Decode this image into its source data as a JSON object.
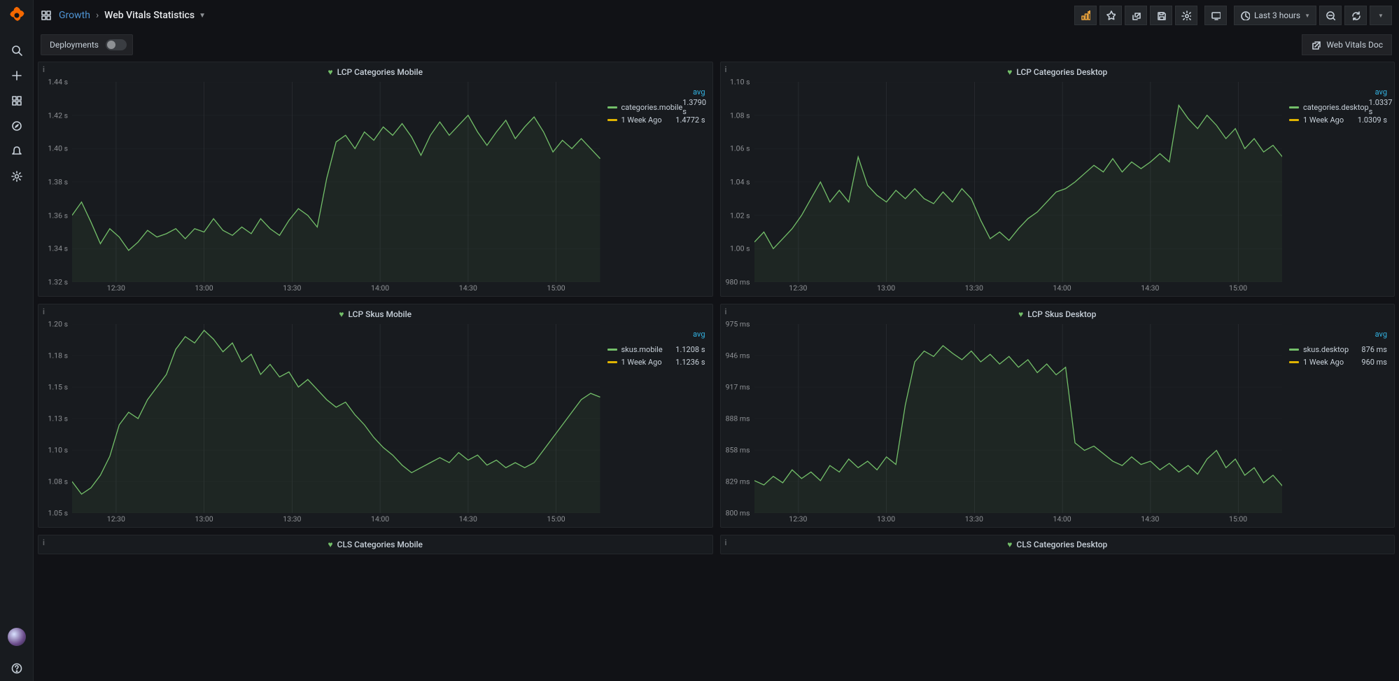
{
  "breadcrumb": {
    "folder": "Growth",
    "title": "Web Vitals Statistics"
  },
  "timepicker": {
    "range_label": "Last 3 hours"
  },
  "submenu": {
    "var_label": "Deployments",
    "doc_link_label": "Web Vitals Doc"
  },
  "legend_header": "avg",
  "panels": [
    {
      "id": "lcp_cat_mobile",
      "title": "LCP Categories Mobile",
      "ylim": [
        1.32,
        1.44
      ],
      "yunit": " s",
      "yfmt": 2,
      "legend": [
        {
          "swatch": "green",
          "label": "categories.mobile",
          "value": "1.3790 s"
        },
        {
          "swatch": "yellow",
          "label": "1 Week Ago",
          "value": "1.4772 s"
        }
      ]
    },
    {
      "id": "lcp_cat_desktop",
      "title": "LCP Categories Desktop",
      "ylim": [
        0.98,
        1.1
      ],
      "yunit": " s",
      "yfmt": 2,
      "ytick_override": [
        "1.10 s",
        "1.08 s",
        "1.06 s",
        "1.04 s",
        "1.02 s",
        "1.00 s",
        "980 ms"
      ],
      "legend": [
        {
          "swatch": "green",
          "label": "categories.desktop",
          "value": "1.0337 s"
        },
        {
          "swatch": "yellow",
          "label": "1 Week Ago",
          "value": "1.0309 s"
        }
      ]
    },
    {
      "id": "lcp_skus_mobile",
      "title": "LCP Skus Mobile",
      "ylim": [
        1.05,
        1.2
      ],
      "yunit": " s",
      "yfmt": 2,
      "ytick_override": [
        "1.20 s",
        "1.18 s",
        "1.15 s",
        "1.13 s",
        "1.10 s",
        "1.08 s",
        "1.05 s"
      ],
      "legend": [
        {
          "swatch": "green",
          "label": "skus.mobile",
          "value": "1.1208 s"
        },
        {
          "swatch": "yellow",
          "label": "1 Week Ago",
          "value": "1.1236 s"
        }
      ]
    },
    {
      "id": "lcp_skus_desktop",
      "title": "LCP Skus Desktop",
      "ylim": [
        800,
        975
      ],
      "yunit": " ms",
      "yfmt": 0,
      "legend": [
        {
          "swatch": "green",
          "label": "skus.desktop",
          "value": "876 ms"
        },
        {
          "swatch": "yellow",
          "label": "1 Week Ago",
          "value": "960 ms"
        }
      ]
    }
  ],
  "stub_panels": [
    {
      "title": "CLS Categories Mobile"
    },
    {
      "title": "CLS Categories Desktop"
    }
  ],
  "x_ticks": [
    "12:30",
    "13:00",
    "13:30",
    "14:00",
    "14:30",
    "15:00"
  ],
  "chart_data": [
    {
      "panel": "lcp_cat_mobile",
      "type": "line",
      "title": "LCP Categories Mobile",
      "ylabel": "",
      "xlabel": "",
      "ylim": [
        1.32,
        1.44
      ],
      "x_ticks": [
        "12:30",
        "13:00",
        "13:30",
        "14:00",
        "14:30",
        "15:00"
      ],
      "series": [
        {
          "name": "categories.mobile",
          "color": "#73bf69",
          "values": [
            1.36,
            1.368,
            1.356,
            1.343,
            1.352,
            1.347,
            1.339,
            1.344,
            1.351,
            1.347,
            1.349,
            1.352,
            1.346,
            1.352,
            1.35,
            1.358,
            1.351,
            1.348,
            1.353,
            1.349,
            1.358,
            1.352,
            1.348,
            1.357,
            1.364,
            1.36,
            1.353,
            1.382,
            1.404,
            1.408,
            1.4,
            1.41,
            1.405,
            1.413,
            1.408,
            1.415,
            1.407,
            1.396,
            1.408,
            1.416,
            1.408,
            1.414,
            1.42,
            1.41,
            1.402,
            1.41,
            1.417,
            1.406,
            1.413,
            1.419,
            1.41,
            1.398,
            1.405,
            1.4,
            1.406,
            1.4,
            1.394
          ]
        }
      ]
    },
    {
      "panel": "lcp_cat_desktop",
      "type": "line",
      "title": "LCP Categories Desktop",
      "ylabel": "",
      "xlabel": "",
      "ylim": [
        0.98,
        1.1
      ],
      "x_ticks": [
        "12:30",
        "13:00",
        "13:30",
        "14:00",
        "14:30",
        "15:00"
      ],
      "series": [
        {
          "name": "categories.desktop",
          "color": "#73bf69",
          "values": [
            1.004,
            1.01,
            1.0,
            1.006,
            1.012,
            1.02,
            1.03,
            1.04,
            1.028,
            1.035,
            1.028,
            1.055,
            1.038,
            1.032,
            1.028,
            1.035,
            1.03,
            1.036,
            1.03,
            1.027,
            1.034,
            1.028,
            1.036,
            1.03,
            1.017,
            1.006,
            1.01,
            1.005,
            1.012,
            1.018,
            1.022,
            1.028,
            1.034,
            1.036,
            1.04,
            1.045,
            1.05,
            1.046,
            1.054,
            1.046,
            1.052,
            1.048,
            1.052,
            1.057,
            1.052,
            1.086,
            1.078,
            1.072,
            1.08,
            1.074,
            1.066,
            1.072,
            1.06,
            1.066,
            1.058,
            1.062,
            1.055
          ]
        }
      ]
    },
    {
      "panel": "lcp_skus_mobile",
      "type": "line",
      "title": "LCP Skus Mobile",
      "ylabel": "",
      "xlabel": "",
      "ylim": [
        1.05,
        1.2
      ],
      "x_ticks": [
        "12:30",
        "13:00",
        "13:30",
        "14:00",
        "14:30",
        "15:00"
      ],
      "series": [
        {
          "name": "skus.mobile",
          "color": "#73bf69",
          "values": [
            1.075,
            1.065,
            1.07,
            1.08,
            1.095,
            1.12,
            1.13,
            1.125,
            1.14,
            1.15,
            1.16,
            1.18,
            1.19,
            1.185,
            1.195,
            1.188,
            1.178,
            1.185,
            1.17,
            1.176,
            1.16,
            1.168,
            1.158,
            1.162,
            1.15,
            1.156,
            1.148,
            1.14,
            1.134,
            1.138,
            1.128,
            1.12,
            1.11,
            1.102,
            1.096,
            1.088,
            1.082,
            1.086,
            1.09,
            1.094,
            1.09,
            1.098,
            1.092,
            1.096,
            1.088,
            1.092,
            1.086,
            1.09,
            1.086,
            1.09,
            1.1,
            1.11,
            1.12,
            1.13,
            1.14,
            1.145,
            1.142
          ]
        }
      ]
    },
    {
      "panel": "lcp_skus_desktop",
      "type": "line",
      "title": "LCP Skus Desktop",
      "ylabel": "",
      "xlabel": "",
      "ylim": [
        800,
        975
      ],
      "x_ticks": [
        "12:30",
        "13:00",
        "13:30",
        "14:00",
        "14:30",
        "15:00"
      ],
      "series": [
        {
          "name": "skus.desktop",
          "color": "#73bf69",
          "values": [
            830,
            826,
            834,
            828,
            840,
            832,
            838,
            830,
            844,
            838,
            850,
            842,
            848,
            840,
            852,
            845,
            900,
            940,
            950,
            945,
            955,
            948,
            942,
            950,
            940,
            947,
            938,
            945,
            935,
            942,
            930,
            938,
            928,
            935,
            865,
            858,
            862,
            855,
            848,
            844,
            852,
            845,
            848,
            840,
            846,
            838,
            844,
            836,
            850,
            858,
            842,
            850,
            835,
            842,
            828,
            835,
            825
          ]
        }
      ]
    }
  ]
}
